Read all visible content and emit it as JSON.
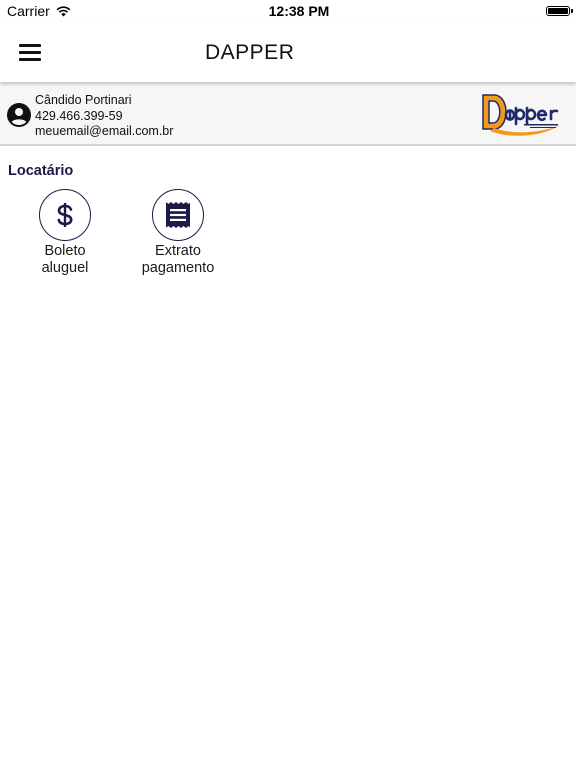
{
  "status_bar": {
    "carrier": "Carrier",
    "time": "12:38 PM"
  },
  "toolbar": {
    "title": "DAPPER"
  },
  "user": {
    "name": "Cândido Portinari",
    "document": "429.466.399-59",
    "email": "meuemail@email.com.br"
  },
  "section": {
    "title": "Locatário"
  },
  "actions": [
    {
      "label": "Boleto\naluguel",
      "icon": "dollar-icon"
    },
    {
      "label": "Extrato\npagamento",
      "icon": "receipt-icon"
    }
  ],
  "colors": {
    "accent": "#1b1a48",
    "logo_orange": "#f39a1d",
    "logo_navy": "#1f2a6b"
  }
}
